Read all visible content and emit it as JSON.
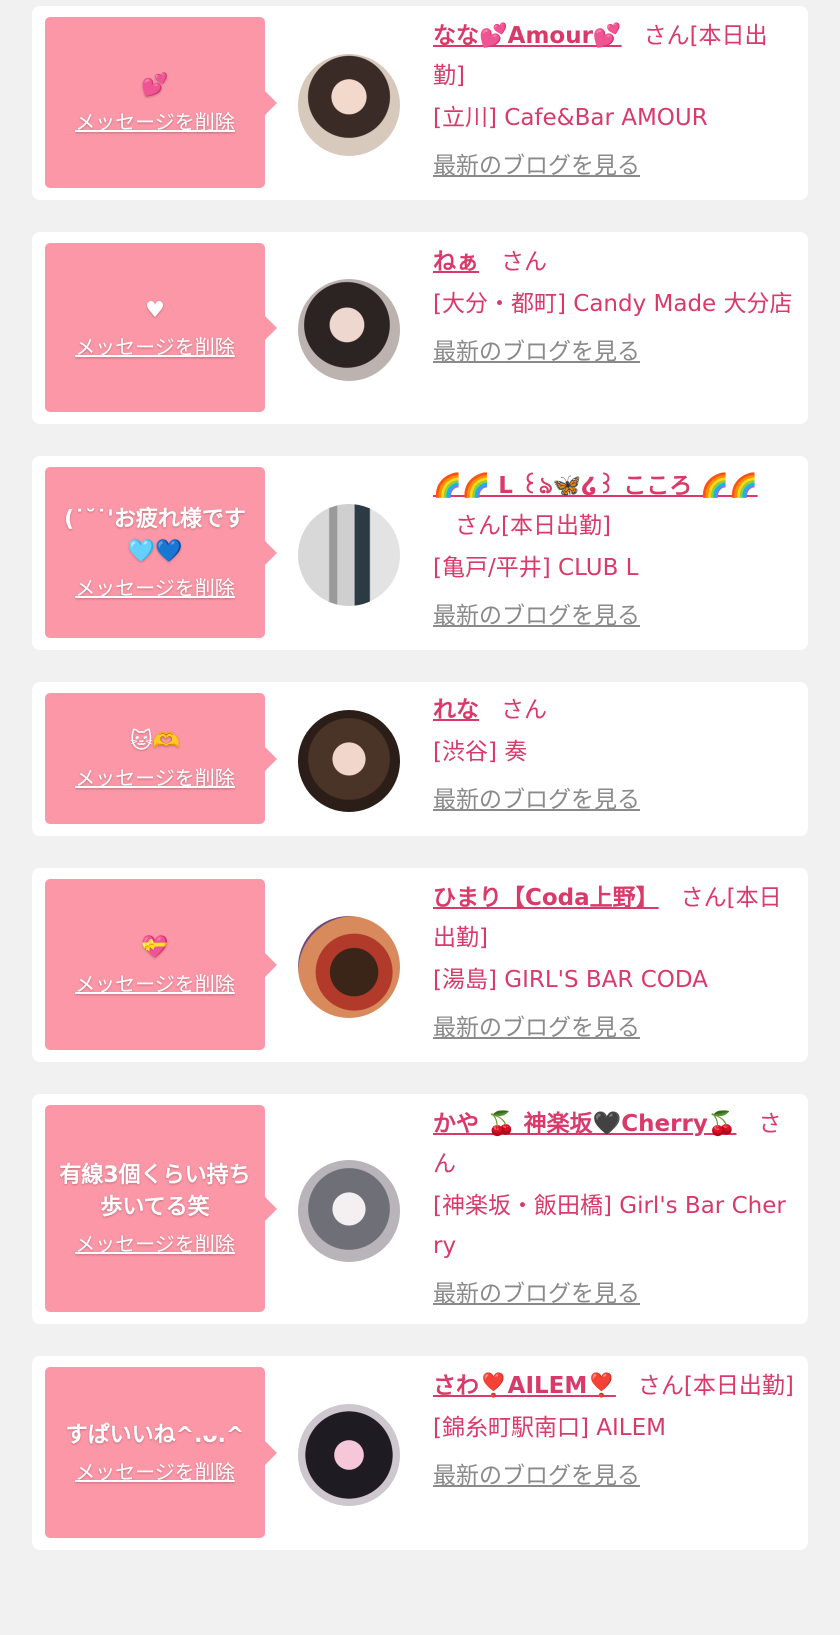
{
  "delete_label": "メッセージを削除",
  "blog_label": "最新のブログを見る",
  "san_label": "さん",
  "today_label": "[本日出勤]",
  "colors": {
    "accent": "#d93a6a",
    "bubble": "#fc97a7",
    "background": "#f1f1f1",
    "link_gray": "#8a8a8a"
  },
  "messages": [
    {
      "message": "💕",
      "name": "なな💕Amour💕",
      "today": true,
      "shop": "[立川] Cafe&Bar AMOUR",
      "avatar_icon": "girl-portrait-photo"
    },
    {
      "message": "♥",
      "name": "ねぁ",
      "today": false,
      "shop": "[大分・都町] Candy Made 大分店",
      "avatar_icon": "girl-portrait-photo"
    },
    {
      "message": "(˙˘˙'お疲れ様です🩵💙",
      "name": "🌈🌈 L ꒰ঌ🦋໒꒱ こころ 🌈🌈",
      "today": true,
      "shop": "[亀戸/平井] CLUB L",
      "avatar_icon": "figure-photo"
    },
    {
      "message": "🐱🫶",
      "name": "れな",
      "today": false,
      "shop": "[渋谷] 奏",
      "avatar_icon": "girl-portrait-photo"
    },
    {
      "message": "💝",
      "name": "ひまり【Coda上野】",
      "today": true,
      "shop": "[湯島] GIRL'S BAR CODA",
      "avatar_icon": "girl-portrait-photo"
    },
    {
      "message": "有線3個くらい持ち歩いてる笑",
      "name": "かや 🍒 神楽坂🖤Cherry🍒",
      "today": false,
      "shop": "[神楽坂・飯田橋] Girl's Bar Cherry",
      "avatar_icon": "girl-portrait-photo"
    },
    {
      "message": "すぱいいね^.ᴗ.^",
      "name": "さわ❣️AILEM❣️",
      "today": true,
      "shop": "[錦糸町駅南口] AILEM",
      "avatar_icon": "girl-portrait-photo"
    }
  ]
}
